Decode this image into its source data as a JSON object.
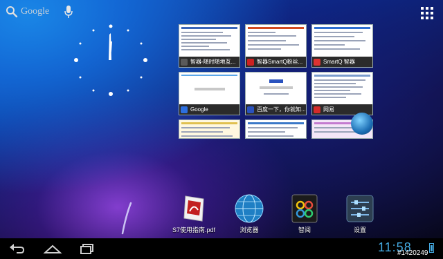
{
  "search": {
    "label": "Google"
  },
  "recents": [
    {
      "title": "智器-随时随地互...",
      "icon_color": "#5a5a5a",
      "accent": "#3a66b8"
    },
    {
      "title": "智器SmartQ粉丝...",
      "icon_color": "#cc2222",
      "accent": "#d24a1f"
    },
    {
      "title": "SmartQ 智器",
      "icon_color": "#dd3333",
      "accent": "#2e6fd0"
    },
    {
      "title": "Google",
      "icon_color": "#2d6fe0",
      "accent": "#5aa6e8"
    },
    {
      "title": "百度一下，你就知...",
      "icon_color": "#2a52be",
      "accent": "#2a52be"
    },
    {
      "title": "网易",
      "icon_color": "#d42b2b",
      "accent": "#7a9ccd"
    },
    {
      "title": "",
      "icon_color": "#d8b43a",
      "accent": "#e0c050"
    },
    {
      "title": "",
      "icon_color": "#3a78c8",
      "accent": "#3a78c8"
    },
    {
      "title": "",
      "icon_color": "#c070c8",
      "accent": "#c47ad0"
    }
  ],
  "dock": [
    {
      "label": "S7使用指南.pdf",
      "icon": "pdf-document-icon"
    },
    {
      "label": "浏览器",
      "icon": "globe-browser-icon"
    },
    {
      "label": "智阅",
      "icon": "reader-app-icon"
    },
    {
      "label": "设置",
      "icon": "settings-sliders-icon"
    }
  ],
  "status": {
    "time": "11:58"
  },
  "watermark": "#1420249",
  "colors": {
    "accent": "#44a9e0"
  }
}
